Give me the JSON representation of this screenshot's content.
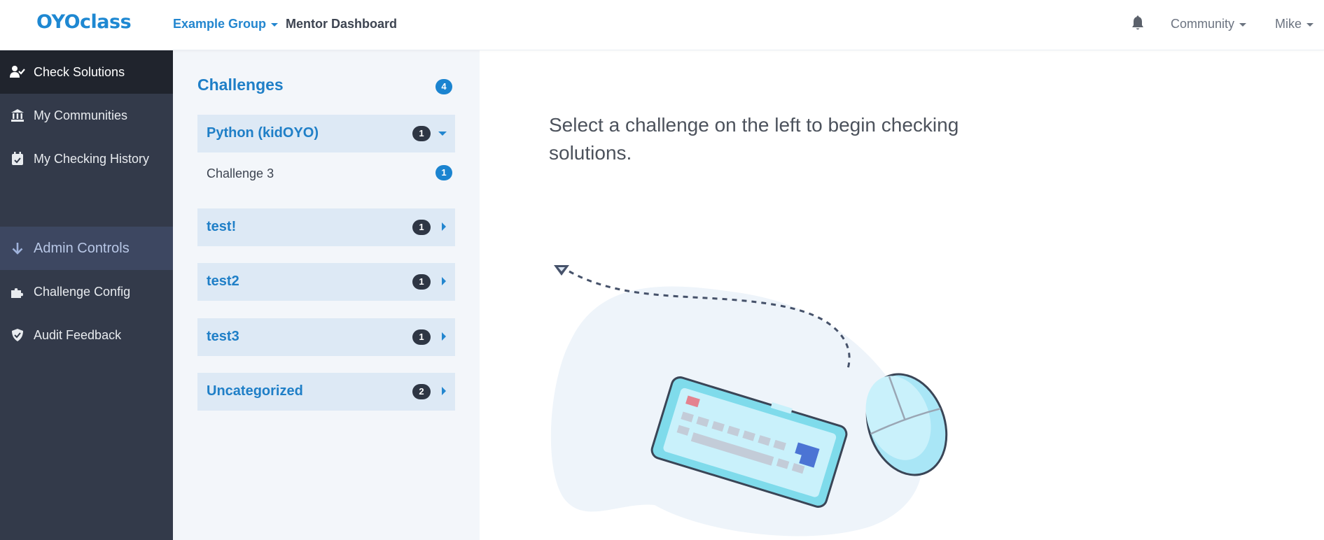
{
  "header": {
    "logo": "OYOclass",
    "group": "Example Group",
    "title": "Mentor Dashboard",
    "nav": {
      "community": "Community",
      "user": "Mike"
    }
  },
  "sidebar": {
    "items": [
      {
        "label": "Check Solutions",
        "icon": "user-check-icon",
        "active": true
      },
      {
        "label": "My Communities",
        "icon": "institution-icon"
      },
      {
        "label": "My Checking History",
        "icon": "calendar-check-icon"
      }
    ],
    "admin": {
      "label": "Admin Controls",
      "icon": "arrow-down-icon"
    },
    "admin_items": [
      {
        "label": "Challenge Config",
        "icon": "puzzle-icon"
      },
      {
        "label": "Audit Feedback",
        "icon": "shield-check-icon"
      }
    ]
  },
  "challenges": {
    "title": "Challenges",
    "count": "4",
    "categories": [
      {
        "label": "Python (kidOYO)",
        "count": "1",
        "expanded": true,
        "items": [
          {
            "label": "Challenge 3",
            "count": "1"
          }
        ]
      },
      {
        "label": "test!",
        "count": "1",
        "expanded": false
      },
      {
        "label": "test2",
        "count": "1",
        "expanded": false
      },
      {
        "label": "test3",
        "count": "1",
        "expanded": false
      },
      {
        "label": "Uncategorized",
        "count": "2",
        "expanded": false
      }
    ]
  },
  "main": {
    "prompt": "Select a challenge on the left to begin checking solutions."
  },
  "colors": {
    "brand": "#1e88d2",
    "sidebar": "#333a4a",
    "sidebar_active": "#20242d",
    "admin_bg": "#3d4761",
    "panel_bg": "#f3f6fa",
    "category_bg": "#dde9f5"
  }
}
